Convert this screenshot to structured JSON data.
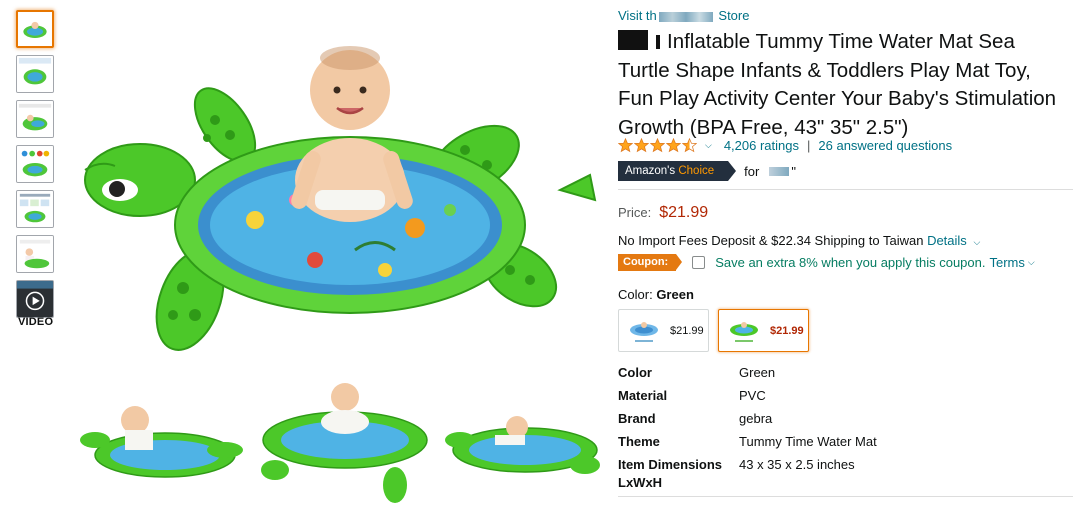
{
  "store": {
    "prefix": "Visit th",
    "suffix": " Store"
  },
  "title": "Inflatable Tummy Time Water Mat Sea Turtle Shape Infants & Toddlers Play Mat Toy, Fun Play Activity Center Your Baby's Stimulation Growth (BPA Free, 43\" 35\" 2.5\")",
  "rating": {
    "stars": 4.5,
    "count_text": "4,206 ratings",
    "questions_text": "26 answered questions",
    "separator": "|"
  },
  "badge": {
    "prefix": "Amazon's",
    "highlight": "Choice",
    "for_text": "for",
    "quote": "\""
  },
  "price": {
    "label": "Price:",
    "value": "$21.99"
  },
  "shipping": {
    "text": "No Import Fees Deposit & $22.34 Shipping to Taiwan",
    "details": "Details"
  },
  "coupon": {
    "badge": "Coupon:",
    "text": "Save an extra 8% when you apply this coupon.",
    "terms": "Terms"
  },
  "color": {
    "label": "Color:",
    "value": "Green"
  },
  "swatches": [
    {
      "name": "Blue",
      "price": "$21.99",
      "selected": false
    },
    {
      "name": "Green",
      "price": "$21.99",
      "selected": true
    }
  ],
  "specs": [
    {
      "key": "Color",
      "value": "Green"
    },
    {
      "key": "Material",
      "value": "PVC"
    },
    {
      "key": "Brand",
      "value": "gebra"
    },
    {
      "key": "Theme",
      "value": "Tummy Time Water Mat"
    },
    {
      "key": "Item Dimensions LxWxH",
      "value": "43 x 35 x 2.5 inches"
    }
  ],
  "thumbnails": {
    "count": 7,
    "video_label": "VIDEO"
  },
  "colors": {
    "link": "#007185",
    "price": "#b12704",
    "coupon": "#e47911",
    "coupon_text": "#067d62",
    "badge_bg": "#232f3e",
    "star": "#ffa41c",
    "selected_border": "#e77600"
  }
}
